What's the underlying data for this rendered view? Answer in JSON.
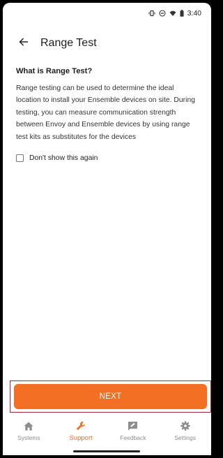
{
  "status_bar": {
    "time": "3:40",
    "icons": [
      "vibrate-icon",
      "do-not-disturb-icon",
      "wifi-icon",
      "battery-icon"
    ]
  },
  "header": {
    "back_icon": "arrow-left-icon",
    "title": "Range Test"
  },
  "main": {
    "heading": "What is Range Test?",
    "description": "Range testing can be used to determine the ideal location to install your Ensemble devices on site. During testing, you can measure communication strength between Envoy and Ensemble devices by using range test kits as substitutes for the devices",
    "dont_show_label": "Don't show this again",
    "dont_show_checked": false
  },
  "next_button": {
    "label": "NEXT"
  },
  "bottom_nav": {
    "items": [
      {
        "label": "Systems",
        "icon": "home-icon",
        "active": false
      },
      {
        "label": "Support",
        "icon": "wrench-icon",
        "active": true
      },
      {
        "label": "Feedback",
        "icon": "feedback-icon",
        "active": false
      },
      {
        "label": "Settings",
        "icon": "gear-icon",
        "active": false
      }
    ]
  },
  "colors": {
    "accent": "#f26f24",
    "highlight_border": "#a3273a",
    "inactive_nav": "#8d8d8d"
  }
}
